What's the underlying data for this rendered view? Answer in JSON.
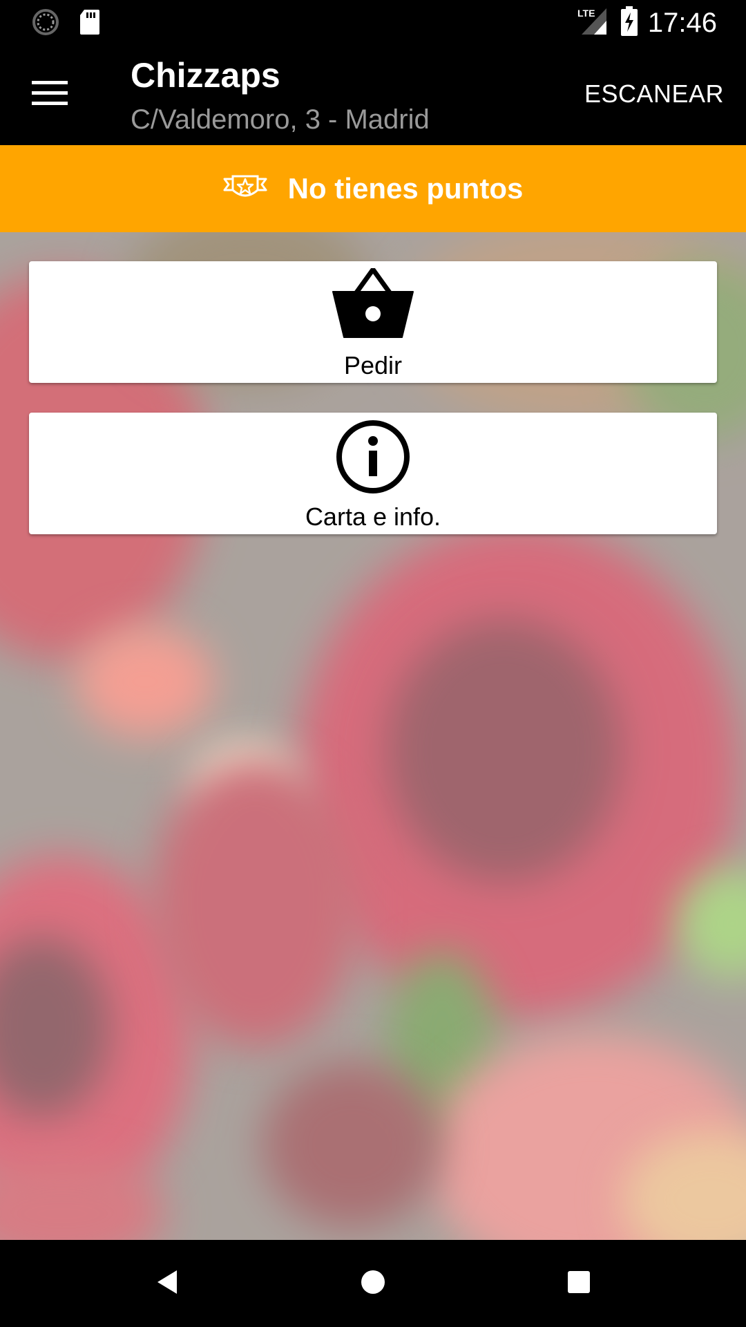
{
  "status_bar": {
    "time": "17:46",
    "network": "LTE",
    "icons": [
      "loading-icon",
      "sd-card-icon",
      "lte-signal-icon",
      "battery-charging-icon"
    ]
  },
  "app_bar": {
    "title": "Chizzaps",
    "subtitle": "C/Valdemoro, 3 - Madrid",
    "action_label": "ESCANEAR",
    "menu_icon": "menu-icon"
  },
  "points_banner": {
    "text": "No tienes puntos",
    "icon": "badge-star-icon",
    "background": "#ffa500"
  },
  "cards": [
    {
      "label": "Pedir",
      "icon": "basket-icon"
    },
    {
      "label": "Carta e info.",
      "icon": "info-icon"
    }
  ],
  "nav_bar": {
    "buttons": [
      "back-icon",
      "home-icon",
      "recents-icon"
    ]
  },
  "colors": {
    "accent": "#ffa500",
    "bar": "#000000",
    "subtitle": "#9a9a9a"
  }
}
